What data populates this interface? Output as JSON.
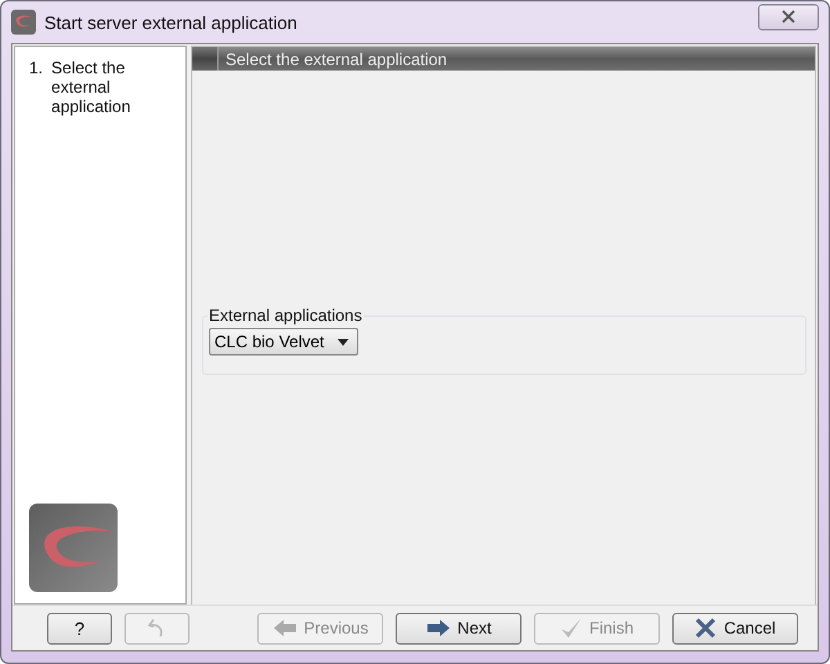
{
  "window": {
    "title": "Start server external application"
  },
  "steps": [
    {
      "number": "1.",
      "label": "Select the external application"
    }
  ],
  "panel": {
    "header": "Select the external application",
    "group_label": "External applications",
    "dropdown_value": "CLC bio Velvet"
  },
  "buttons": [
    {
      "kind": "help",
      "label": "?",
      "disabled": false
    },
    {
      "kind": "back",
      "disabled": true
    },
    {
      "kind": "previous",
      "label": "Previous",
      "disabled": true
    },
    {
      "kind": "next",
      "label": "Next",
      "disabled": false
    },
    {
      "kind": "finish",
      "label": "Finish",
      "disabled": true
    },
    {
      "kind": "cancel",
      "label": "Cancel",
      "disabled": false
    }
  ]
}
